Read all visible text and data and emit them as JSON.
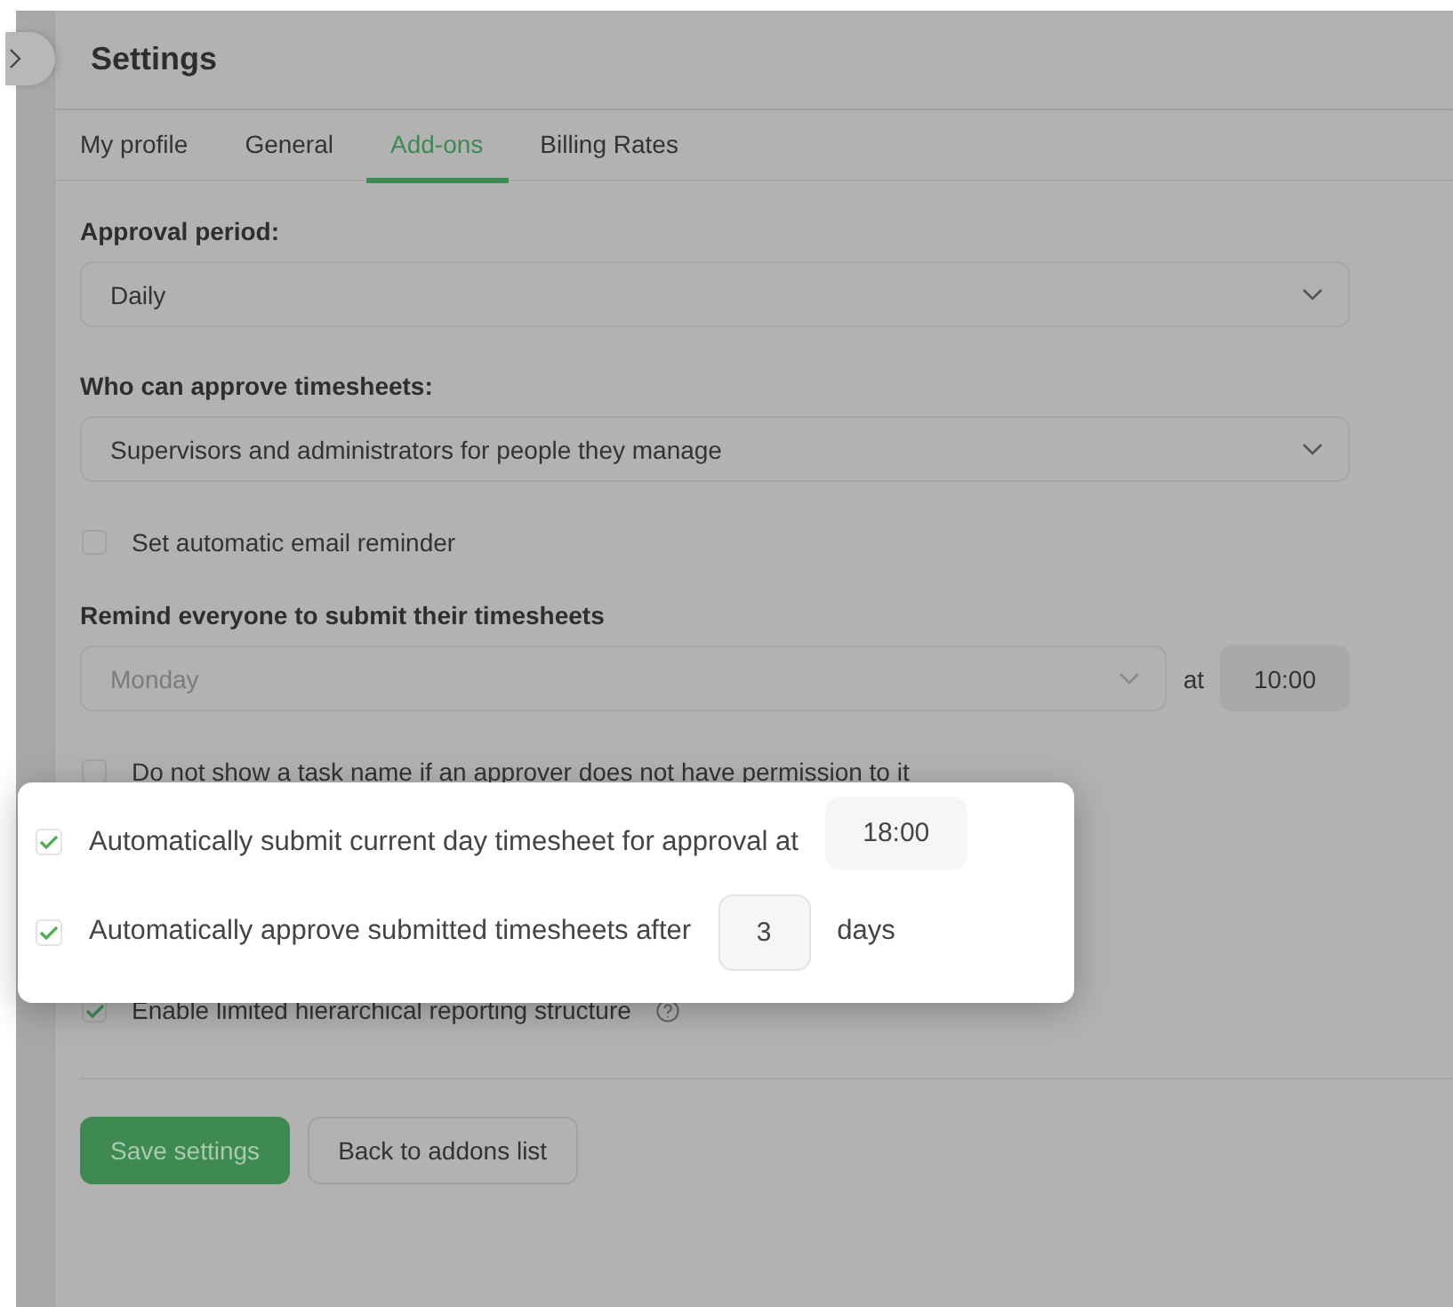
{
  "header": {
    "title": "Settings"
  },
  "tabs": [
    {
      "label": "My profile",
      "selected": false
    },
    {
      "label": "General",
      "selected": false
    },
    {
      "label": "Add-ons",
      "selected": true
    },
    {
      "label": "Billing Rates",
      "selected": false
    }
  ],
  "approval_period": {
    "label": "Approval period:",
    "value": "Daily"
  },
  "approvers": {
    "label": "Who can approve timesheets:",
    "value": "Supervisors and administrators for people they manage"
  },
  "email_reminder": {
    "label": "Set automatic email reminder",
    "checked": false
  },
  "reminder": {
    "label": "Remind everyone to submit their timesheets",
    "day": "Monday",
    "at": "at",
    "time": "10:00"
  },
  "options": [
    {
      "label": "Do not show a task name if an approver does not have permission to it",
      "checked": false,
      "help": false
    },
    {
      "label": "Enable limited hierarchical reporting structure",
      "checked": true,
      "help": true
    }
  ],
  "highlight_card": {
    "items": [
      {
        "kind": "time",
        "label": "Automatically submit current day timesheet for approval at",
        "checked": true,
        "value": "18:00"
      },
      {
        "kind": "days",
        "label": "Automatically approve submitted timesheets after",
        "checked": true,
        "value": "3",
        "suffix": "days"
      }
    ]
  },
  "buttons": {
    "save": "Save settings",
    "back": "Back to addons list"
  }
}
